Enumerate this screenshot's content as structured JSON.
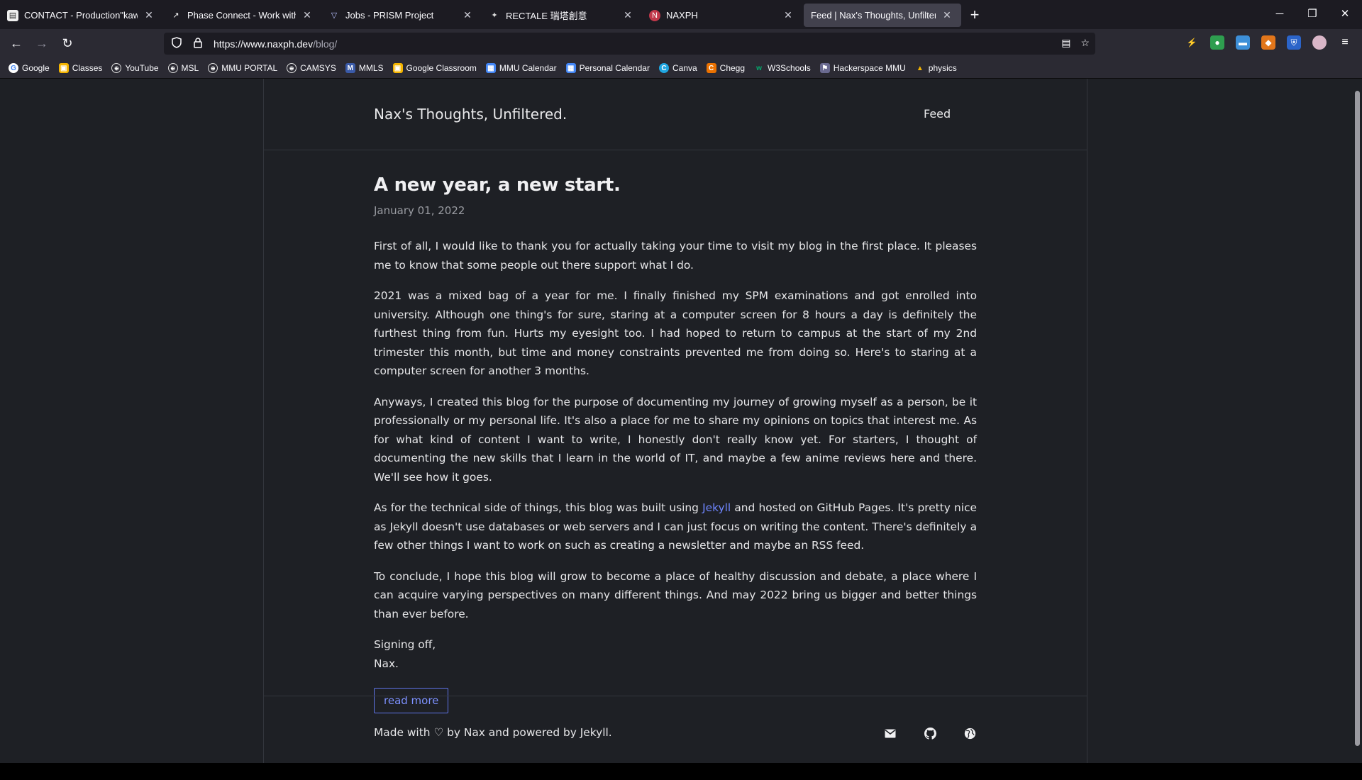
{
  "browser": {
    "tabs": [
      {
        "label": "CONTACT - Production\"kawaii\"",
        "icon": "page-icon",
        "close": "✕"
      },
      {
        "label": "Phase Connect - Work with Us",
        "icon": "phase-connect-icon",
        "close": "✕"
      },
      {
        "label": "Jobs - PRISM Project",
        "icon": "prism-icon",
        "close": "✕"
      },
      {
        "label": "RECTALE 瑞塔創意",
        "icon": "rectale-icon",
        "close": "✕"
      },
      {
        "label": "NAXPH",
        "icon": "naxph-icon",
        "close": "✕"
      },
      {
        "label": "Feed | Nax's Thoughts, Unfiltered.",
        "icon": "none",
        "close": "✕"
      }
    ],
    "url_domain": "https://www.naxph.dev",
    "url_path": "/blog/",
    "bookmarks": [
      {
        "label": "Google",
        "icon": "google-icon",
        "color": "#ffffff"
      },
      {
        "label": "Classes",
        "icon": "classes-icon",
        "color": "#f4b400"
      },
      {
        "label": "YouTube",
        "icon": "globe-icon",
        "color": "transparent"
      },
      {
        "label": "MSL",
        "icon": "globe-icon",
        "color": "transparent"
      },
      {
        "label": "MMU PORTAL",
        "icon": "globe-icon",
        "color": "transparent"
      },
      {
        "label": "CAMSYS",
        "icon": "globe-icon",
        "color": "transparent"
      },
      {
        "label": "MMLS",
        "icon": "mmls-icon",
        "color": "#3a5aa8"
      },
      {
        "label": "Google Classroom",
        "icon": "classroom-icon",
        "color": "#f4b400"
      },
      {
        "label": "MMU Calendar",
        "icon": "calendar-icon",
        "color": "#4285f4"
      },
      {
        "label": "Personal Calendar",
        "icon": "calendar-icon",
        "color": "#4285f4"
      },
      {
        "label": "Canva",
        "icon": "canva-icon",
        "color": "#1fa5e0"
      },
      {
        "label": "Chegg",
        "icon": "chegg-icon",
        "color": "#eb7100"
      },
      {
        "label": "W3Schools",
        "icon": "w3schools-icon",
        "color": "#04aa6d"
      },
      {
        "label": "Hackerspace MMU",
        "icon": "hackerspace-icon",
        "color": "#6a6a90"
      },
      {
        "label": "physics",
        "icon": "drive-icon",
        "color": "#f4b400"
      }
    ]
  },
  "site": {
    "title": "Nax's Thoughts, Unfiltered.",
    "nav_feed": "Feed"
  },
  "post": {
    "title": "A new year, a new start.",
    "date": "January 01, 2022",
    "p1": "First of all, I would like to thank you for actually taking your time to visit my blog in the first place. It pleases me to know that some people out there support what I do.",
    "p2": "2021 was a mixed bag of a year for me. I finally finished my SPM examinations and got enrolled into university. Although one thing's for sure, staring at a computer screen for 8 hours a day is definitely the furthest thing from fun. Hurts my eyesight too. I had hoped to return to campus at the start of my 2nd trimester this month, but time and money constraints prevented me from doing so. Here's to staring at a computer screen for another 3 months.",
    "p3": "Anyways, I created this blog for the purpose of documenting my journey of growing myself as a person, be it professionally or my personal life. It's also a place for me to share my opinions on topics that interest me. As for what kind of content I want to write, I honestly don't really know yet. For starters, I thought of documenting the new skills that I learn in the world of IT, and maybe a few anime reviews here and there. We'll see how it goes.",
    "p4_before": "As for the technical side of things, this blog was built using ",
    "p4_link": "Jekyll",
    "p4_after": " and hosted on GitHub Pages. It's pretty nice as Jekyll doesn't use databases or web servers and I can just focus on writing the content. There's definitely a few other things I want to work on such as creating a newsletter and maybe an RSS feed.",
    "p5": "To conclude, I hope this blog will grow to become a place of healthy discussion and debate, a place where I can acquire varying perspectives on many different things. And may 2022 bring us bigger and better things than ever before.",
    "signoff_1": "Signing off,",
    "signoff_2": "Nax.",
    "read_more": "read more"
  },
  "footer": {
    "text": "Made with ♡ by Nax and powered by Jekyll.",
    "icons": [
      "mail-icon",
      "github-icon",
      "globe-icon"
    ]
  },
  "colors": {
    "page_bg": "#1e2025",
    "link": "#6f86ff",
    "chrome_bg": "#2b2a33",
    "tabbar_bg": "#1c1b22"
  }
}
